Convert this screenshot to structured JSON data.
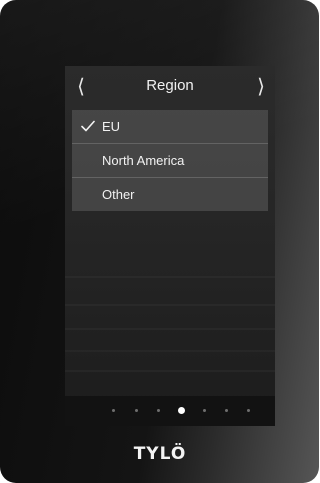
{
  "header": {
    "title": "Region",
    "prev_icon": "‹",
    "next_icon": "›"
  },
  "region_options": [
    {
      "label": "EU",
      "selected": true
    },
    {
      "label": "North America",
      "selected": false
    },
    {
      "label": "Other",
      "selected": false
    }
  ],
  "pager": {
    "page_count": 7,
    "active_page": 4
  },
  "brand": {
    "logo_text": "TYLÖ"
  },
  "colors": {
    "device_body": "#111111",
    "list_item_bg": "#5c5c5c",
    "text": "#f2f2f2",
    "active_dot": "#ffffff",
    "inactive_dot": "#6e6e6e"
  }
}
